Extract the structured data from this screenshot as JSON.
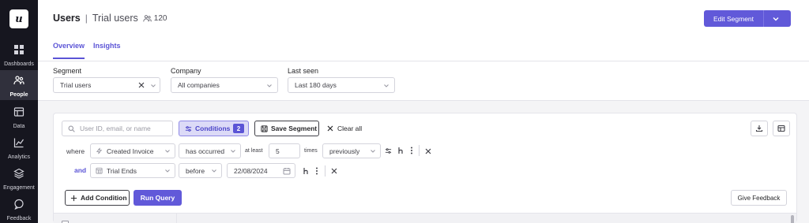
{
  "sidebar": {
    "logo": "u",
    "items": [
      {
        "label": "Dashboards",
        "icon": "dashboard-icon"
      },
      {
        "label": "People",
        "icon": "people-icon",
        "active": true
      },
      {
        "label": "Data",
        "icon": "data-icon"
      },
      {
        "label": "Analytics",
        "icon": "analytics-icon"
      },
      {
        "label": "Engagement",
        "icon": "engagement-icon"
      },
      {
        "label": "Feedback",
        "icon": "feedback-icon"
      }
    ]
  },
  "header": {
    "title": "Users",
    "separator": "|",
    "segment_name": "Trial users",
    "user_count": "120",
    "edit_button": "Edit Segment",
    "tabs": [
      {
        "label": "Overview",
        "active": true
      },
      {
        "label": "Insights",
        "active": false
      }
    ]
  },
  "filters": {
    "segment": {
      "label": "Segment",
      "value": "Trial users"
    },
    "company": {
      "label": "Company",
      "value": "All companies"
    },
    "last_seen": {
      "label": "Last seen",
      "value": "Last 180 days"
    }
  },
  "query": {
    "search_placeholder": "User ID, email, or name",
    "conditions_label": "Conditions",
    "conditions_count": "2",
    "save_segment": "Save Segment",
    "clear_all": "Clear all",
    "rows": [
      {
        "connector": "where",
        "field": "Created Invoice",
        "operator": "has occurred",
        "qualifier": "at least",
        "count": "5",
        "unit": "times",
        "period": "previously"
      },
      {
        "connector": "and",
        "field": "Trial Ends",
        "operator": "before",
        "date": "22/08/2024"
      }
    ],
    "add_condition": "Add Condition",
    "run_query": "Run Query",
    "give_feedback": "Give Feedback"
  },
  "colors": {
    "accent": "#6159d9",
    "sidebar_bg": "#16161f"
  }
}
